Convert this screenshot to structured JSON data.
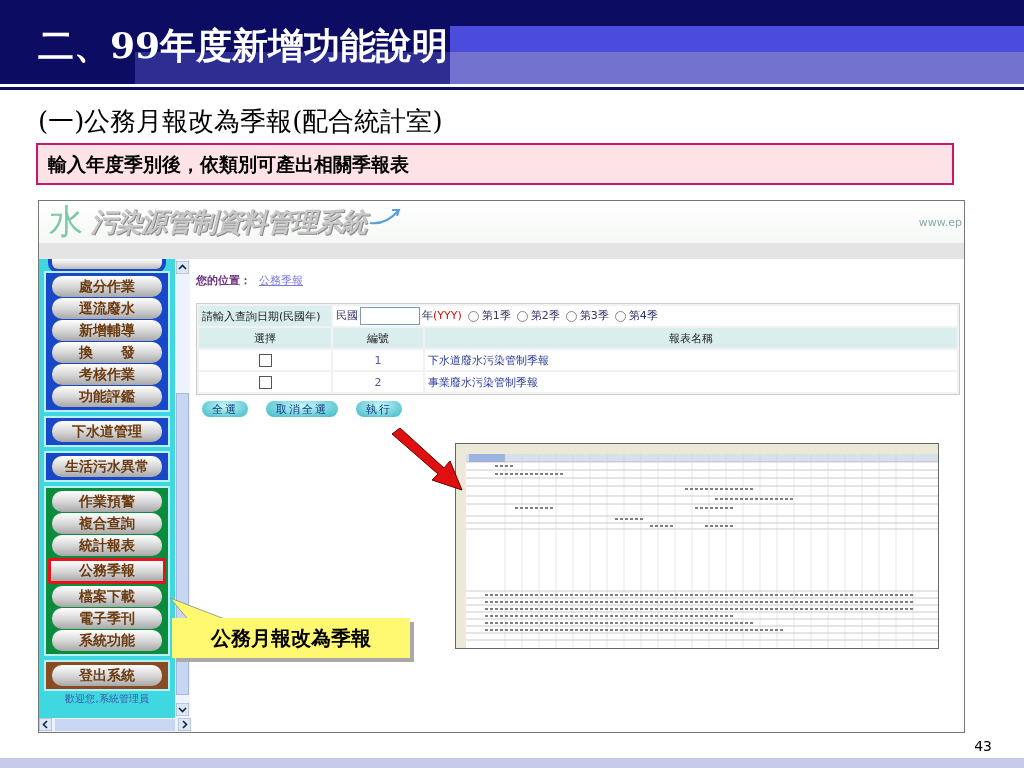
{
  "slide": {
    "title": "二、99年度新增功能說明",
    "subtitle": "(一)公務月報改為季報(配合統計室)",
    "note": "輸入年度季別後，依類別可產出相關季報表",
    "page_number": "43"
  },
  "app": {
    "logo": {
      "mark": "水",
      "name": "污染源管制資料管理系統",
      "url": "www.ep"
    },
    "sidebar": {
      "groups": [
        {
          "color": "#1848c8",
          "items": [
            {
              "label": "處分作業",
              "selected": false
            },
            {
              "label": "逕流廢水",
              "selected": false
            },
            {
              "label": "新增輔導",
              "selected": false
            },
            {
              "label": "換　　發",
              "selected": false
            },
            {
              "label": "考核作業",
              "selected": false
            },
            {
              "label": "功能評鑑",
              "selected": false
            }
          ]
        },
        {
          "color": "#1848c8",
          "items": [
            {
              "label": "下水道管理",
              "selected": false
            }
          ]
        },
        {
          "color": "#1848c8",
          "items": [
            {
              "label": "生活污水異常",
              "selected": false
            }
          ]
        },
        {
          "color": "#0a8c3c",
          "items": [
            {
              "label": "作業預警",
              "selected": false
            },
            {
              "label": "複合查詢",
              "selected": false
            },
            {
              "label": "統計報表",
              "selected": false
            },
            {
              "label": "公務季報",
              "selected": true
            },
            {
              "label": "檔案下載",
              "selected": false
            },
            {
              "label": "電子季刊",
              "selected": false
            },
            {
              "label": "系統功能",
              "selected": false
            }
          ]
        },
        {
          "color": "#8a4a22",
          "items": [
            {
              "label": "登出系統",
              "selected": false
            }
          ]
        }
      ],
      "welcome": "歡迎您,系統管理員"
    },
    "breadcrumb": {
      "label": "您的位置：",
      "link": "公務季報"
    },
    "query": {
      "label": "請輸入查詢日期(民國年)",
      "prefix": "民國",
      "suffix": "年",
      "format": "(YYY)",
      "quarters": [
        {
          "label": "第1季",
          "selected": false
        },
        {
          "label": "第2季",
          "selected": false
        },
        {
          "label": "第3季",
          "selected": false
        },
        {
          "label": "第4季",
          "selected": false
        }
      ]
    },
    "table": {
      "columns": [
        "選擇",
        "編號",
        "報表名稱"
      ],
      "rows": [
        {
          "checked": false,
          "number": "1",
          "name": "下水道廢水污染管制季報"
        },
        {
          "checked": false,
          "number": "2",
          "name": "事業廢水污染管制季報"
        }
      ]
    },
    "buttons": [
      "全選",
      "取消全選",
      "執行"
    ]
  },
  "callout": {
    "text": "公務月報改為季報"
  }
}
